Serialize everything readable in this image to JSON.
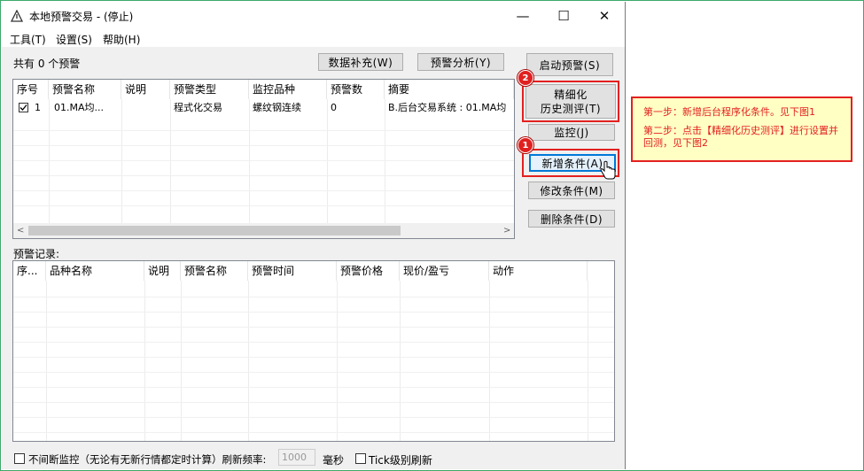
{
  "window": {
    "title": "本地预警交易 - (停止)",
    "controls": {
      "minimize": "—",
      "maximize": "☐",
      "close": "✕"
    }
  },
  "menu": [
    "工具(T)",
    "设置(S)",
    "帮助(H)"
  ],
  "alerts": {
    "count_label": "共有 0 个预警",
    "toolbar": {
      "supplement": "数据补充(W)",
      "analysis": "预警分析(Y)"
    },
    "columns": [
      "序号",
      "预警名称",
      "说明",
      "预警类型",
      "监控品种",
      "预警数",
      "摘要"
    ],
    "rows": [
      {
        "checked": true,
        "index": "1",
        "name": "01.MA均...",
        "desc": "",
        "type": "程式化交易",
        "symbol": "螺纹钢连续",
        "count": "0",
        "summary": "B.后台交易系统 : 01.MA均"
      }
    ]
  },
  "side_buttons": {
    "start": "启动预警(S)",
    "fine_line1": "精细化",
    "fine_line2": "历史测评(T)",
    "monitor": "监控(J)",
    "add": "新增条件(A)",
    "modify": "修改条件(M)",
    "delete": "删除条件(D)"
  },
  "badges": {
    "one": "1",
    "two": "2"
  },
  "records": {
    "label": "预警记录:",
    "columns": [
      "序...",
      "品种名称",
      "说明",
      "预警名称",
      "预警时间",
      "预警价格",
      "现价/盈亏",
      "动作"
    ]
  },
  "footer": {
    "continuous": "不间断监控（无论有无新行情都定时计算）刷新频率:",
    "interval_value": "1000",
    "unit": "毫秒",
    "tick": "Tick级别刷新"
  },
  "callout": {
    "step1": "第一步：新增后台程序化条件。见下图1",
    "step2": "第二步：点击【精细化历史测评】进行设置并回测，见下图2"
  },
  "colors": {
    "highlight_red": "#e32020",
    "callout_bg": "#ffffc4",
    "frame_green": "#3da86a"
  }
}
